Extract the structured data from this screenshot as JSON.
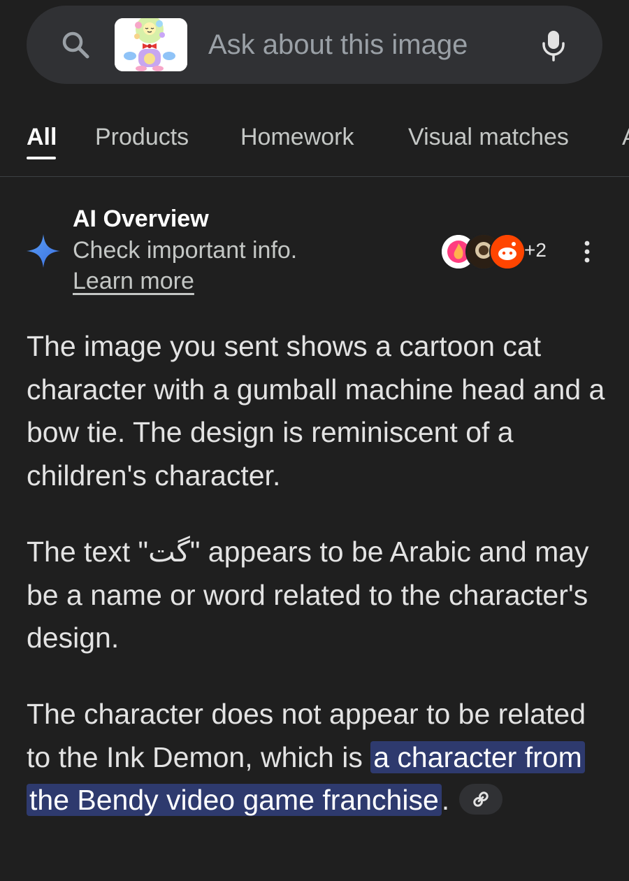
{
  "search": {
    "placeholder": "Ask about this image"
  },
  "tabs": [
    {
      "label": "All",
      "active": true
    },
    {
      "label": "Products",
      "active": false
    },
    {
      "label": "Homework",
      "active": false
    },
    {
      "label": "Visual matches",
      "active": false
    },
    {
      "label": "A",
      "active": false
    }
  ],
  "ai_overview": {
    "title": "AI Overview",
    "subtitle": "Check important info.",
    "learn_more": "Learn more",
    "sources_more": "+2"
  },
  "answer": {
    "p1": "The image you sent shows a cartoon cat character with a gumball machine head and a bow tie. The design is reminiscent of a children's character.",
    "p2": "The text \"گت\" appears to be Arabic and may be a name or word related to the character's design.",
    "p3_plain": "The character does not appear to be related to the Ink Demon, which is ",
    "p3_highlight": "a character from the Bendy video game franchise",
    "p3_end": "."
  },
  "colors": {
    "background": "#1f1f1f",
    "search_bar": "#303134",
    "highlight": "#2e3a6e",
    "accent_blue": "#4c8df6"
  },
  "icons": [
    "search-icon",
    "mic-icon",
    "sparkle-icon",
    "more-vert-icon",
    "link-icon"
  ]
}
